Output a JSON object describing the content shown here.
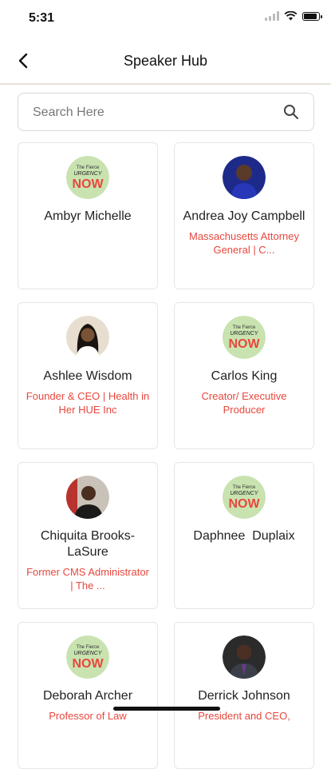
{
  "status_bar": {
    "time": "5:31"
  },
  "header": {
    "title": "Speaker Hub"
  },
  "search": {
    "placeholder": "Search Here",
    "value": ""
  },
  "speakers": [
    {
      "name": "Ambyr Michelle",
      "title": "",
      "avatar": "event-logo"
    },
    {
      "name": "Andrea Joy Campbell",
      "title": "Massachusetts Attorney General | C...",
      "avatar": "photo"
    },
    {
      "name": "Ashlee Wisdom",
      "title": "Founder & CEO | Health in Her HUE Inc",
      "avatar": "photo"
    },
    {
      "name": "Carlos King",
      "title": "Creator/ Executive Producer",
      "avatar": "event-logo"
    },
    {
      "name": "Chiquita Brooks-LaSure",
      "title": "Former CMS Administrator | The ...",
      "avatar": "photo"
    },
    {
      "name": "Daphnee  Duplaix",
      "title": "",
      "avatar": "event-logo"
    },
    {
      "name": "Deborah Archer",
      "title": "Professor of Law",
      "avatar": "event-logo"
    },
    {
      "name": "Derrick Johnson",
      "title": "President and CEO,",
      "avatar": "photo"
    }
  ],
  "logo_text": {
    "line1": "The Fierce",
    "line2": "URGENCY",
    "line3": "NOW"
  },
  "colors": {
    "accent_red": "#e8473d",
    "logo_green": "#c9e3b0",
    "border": "#e6e6e6"
  }
}
